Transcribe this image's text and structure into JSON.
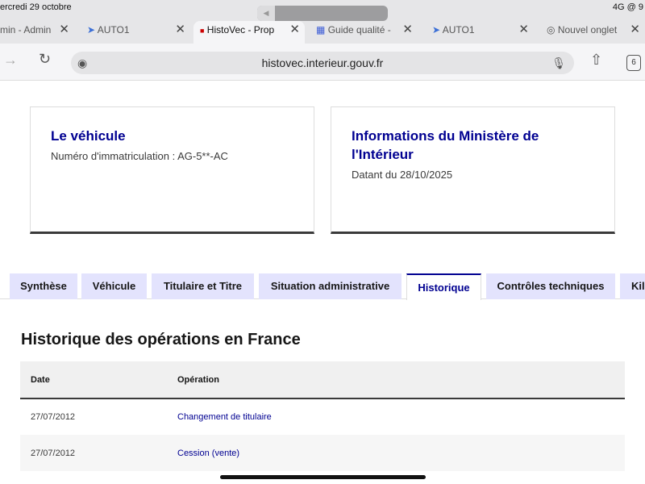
{
  "status": {
    "date": "ercredi 29 octobre",
    "right": "4G @ 9"
  },
  "browser": {
    "tabs": [
      {
        "label": "min - Admin"
      },
      {
        "label": "AUTO1"
      },
      {
        "label": "HistoVec - Prop"
      },
      {
        "label": "Guide qualité -"
      },
      {
        "label": "AUTO1"
      },
      {
        "label": "Nouvel onglet"
      }
    ],
    "url": "histovec.interieur.gouv.fr",
    "tab_count": "6"
  },
  "cards": [
    {
      "title": "Le véhicule",
      "text": "Numéro d'immatriculation : AG-5**-AC"
    },
    {
      "title": "Informations du Ministère de l'Intérieur",
      "text": "Datant du 28/10/2025"
    }
  ],
  "page_tabs": [
    "Synthèse",
    "Véhicule",
    "Titulaire et Titre",
    "Situation administrative",
    "Historique",
    "Contrôles techniques",
    "Kilo"
  ],
  "section": {
    "title": "Historique des opérations en France",
    "headers": [
      "Date",
      "Opération"
    ],
    "rows": [
      [
        "27/07/2012",
        "Changement de titulaire"
      ],
      [
        "27/07/2012",
        "Cession (vente)"
      ]
    ]
  }
}
